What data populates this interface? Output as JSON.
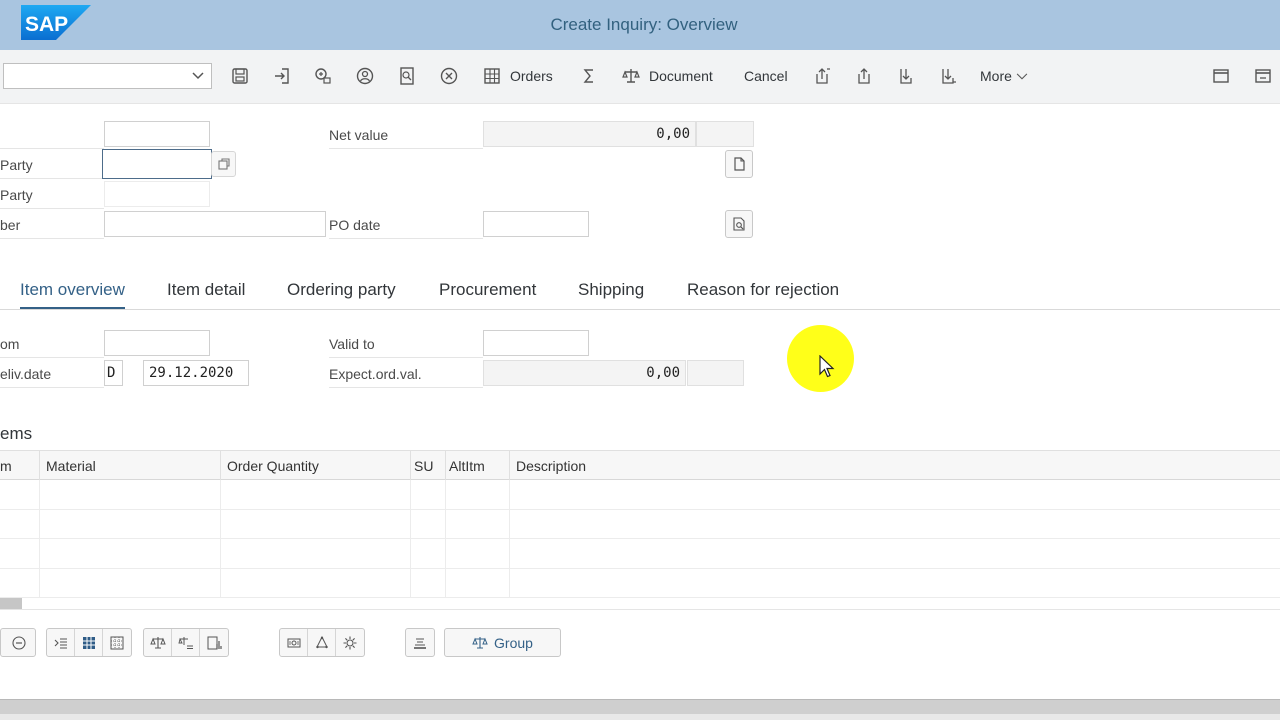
{
  "window": {
    "title": "Create Inquiry: Overview",
    "logo_text": "SAP"
  },
  "toolbar": {
    "select_value": "",
    "orders_label": "Orders",
    "document_label": "Document",
    "cancel_label": "Cancel",
    "more_label": "More"
  },
  "header": {
    "sold_to_label": "",
    "ship_to_label": "Party",
    "ship_to2_label": "Party",
    "po_number_label": "ber",
    "net_value_label": "Net value",
    "net_value": "0,00",
    "net_currency": "",
    "po_date_label": "PO date",
    "po_date": ""
  },
  "tabs": [
    {
      "label": "Item overview",
      "active": true
    },
    {
      "label": "Item detail"
    },
    {
      "label": "Ordering party"
    },
    {
      "label": "Procurement"
    },
    {
      "label": "Shipping"
    },
    {
      "label": "Reason for rejection"
    }
  ],
  "dates": {
    "valid_from_label": "om",
    "valid_to_label": "Valid to",
    "valid_to": "",
    "req_deliv_label": "eliv.date",
    "date_format": "D",
    "req_deliv_date": "29.12.2020",
    "expect_label": "Expect.ord.val.",
    "expect_value": "0,00"
  },
  "items": {
    "title": "ems",
    "columns": [
      "m",
      "Material",
      "Order Quantity",
      "SU",
      "AltItm",
      "Description"
    ],
    "rows": 4
  },
  "bottom": {
    "group_label": "Group"
  },
  "colors": {
    "titlebar": "#a9c5e0",
    "accent": "#346187",
    "cursor_highlight": "#ffff00"
  }
}
